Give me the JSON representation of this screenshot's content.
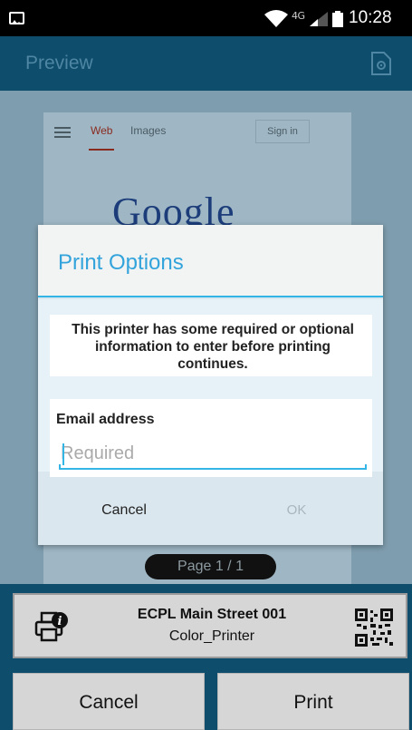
{
  "status_bar": {
    "time": "10:28",
    "network": "4G"
  },
  "action_bar": {
    "title": "Preview"
  },
  "preview": {
    "tabs": [
      "Web",
      "Images"
    ],
    "sign_in": "Sign in",
    "logo": "Google"
  },
  "dialog": {
    "title": "Print Options",
    "message": "This printer has some required or optional information to enter before printing continues.",
    "field_label": "Email address",
    "field_placeholder": "Required",
    "field_value": "",
    "cancel": "Cancel",
    "ok": "OK"
  },
  "page_indicator": "Page 1 / 1",
  "printer": {
    "name": "ECPL Main Street 001",
    "model": "Color_Printer"
  },
  "buttons": {
    "cancel": "Cancel",
    "print": "Print"
  },
  "colors": {
    "accent": "#33b5e5",
    "app_bar": "#0e4d6c",
    "title": "#33a4db"
  },
  "icons": [
    "gallery-icon",
    "wifi-icon",
    "signal-icon",
    "battery-icon",
    "settings-doc-icon",
    "menu-icon",
    "printer-info-icon",
    "qr-code-icon"
  ]
}
